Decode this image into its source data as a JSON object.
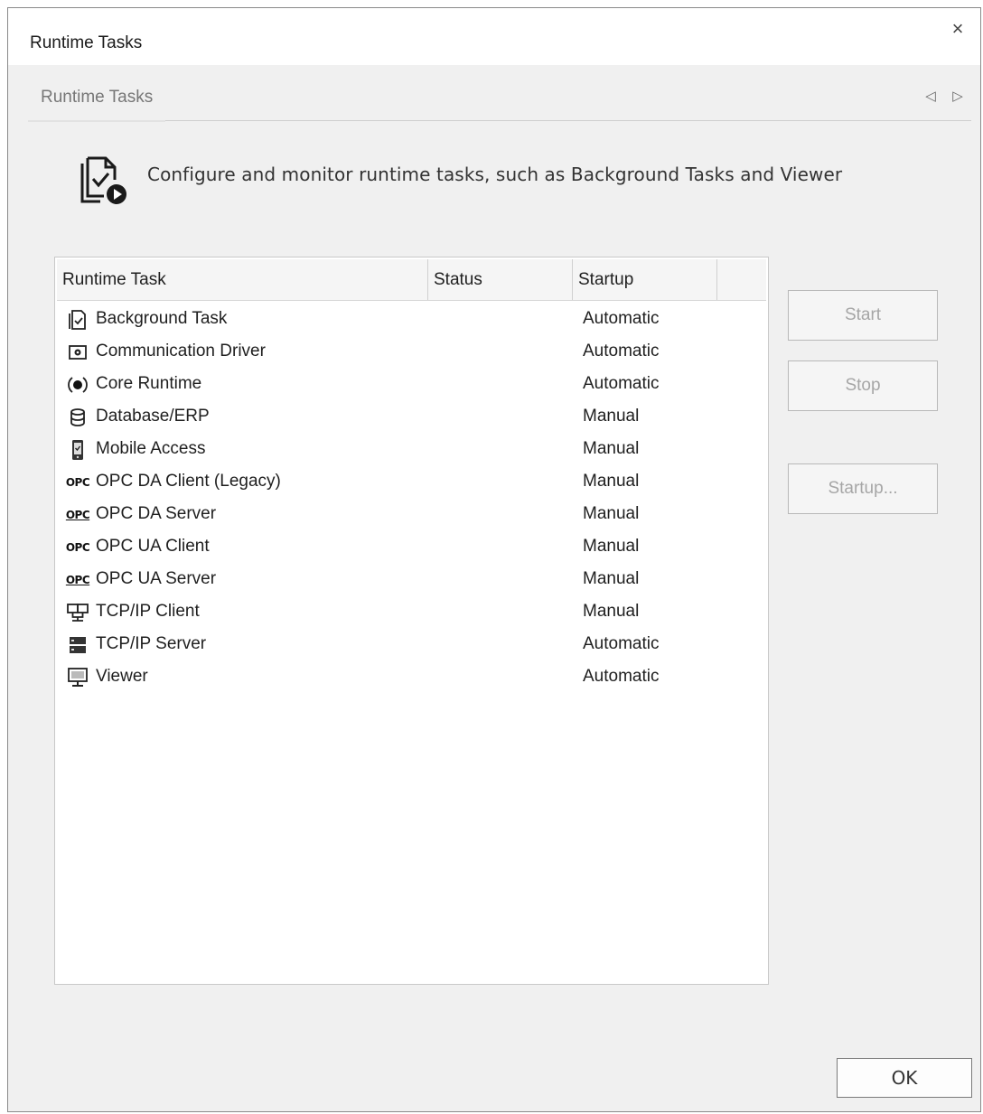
{
  "window": {
    "title": "Runtime Tasks",
    "close_label": "×"
  },
  "tab": {
    "label": "Runtime Tasks",
    "prev_label": "◁",
    "next_label": "▷"
  },
  "header": {
    "description": "Configure and monitor runtime tasks, such as Background Tasks and Viewer"
  },
  "table": {
    "columns": [
      "Runtime Task",
      "Status",
      "Startup"
    ],
    "rows": [
      {
        "icon": "checklist-document-icon",
        "name": "Background Task",
        "status": "",
        "startup": "Automatic"
      },
      {
        "icon": "driver-gear-icon",
        "name": "Communication Driver",
        "status": "",
        "startup": "Automatic"
      },
      {
        "icon": "radio-core-icon",
        "name": "Core Runtime",
        "status": "",
        "startup": "Automatic"
      },
      {
        "icon": "database-icon",
        "name": "Database/ERP",
        "status": "",
        "startup": "Manual"
      },
      {
        "icon": "mobile-phone-icon",
        "name": "Mobile Access",
        "status": "",
        "startup": "Manual"
      },
      {
        "icon": "opc-icon",
        "icon_text": "OPC",
        "name": "OPC DA Client (Legacy)",
        "status": "",
        "startup": "Manual"
      },
      {
        "icon": "opc-server-icon",
        "icon_text": "OPC",
        "name": "OPC DA Server",
        "status": "",
        "startup": "Manual"
      },
      {
        "icon": "opc-icon",
        "icon_text": "OPC",
        "name": "OPC UA Client",
        "status": "",
        "startup": "Manual"
      },
      {
        "icon": "opc-server-icon",
        "icon_text": "OPC",
        "name": "OPC UA Server",
        "status": "",
        "startup": "Manual"
      },
      {
        "icon": "network-computers-icon",
        "name": "TCP/IP Client",
        "status": "",
        "startup": "Manual"
      },
      {
        "icon": "server-rack-icon",
        "name": "TCP/IP Server",
        "status": "",
        "startup": "Automatic"
      },
      {
        "icon": "monitor-icon",
        "name": "Viewer",
        "status": "",
        "startup": "Automatic"
      }
    ]
  },
  "buttons": {
    "start": "Start",
    "stop": "Stop",
    "startup": "Startup...",
    "ok": "OK"
  }
}
